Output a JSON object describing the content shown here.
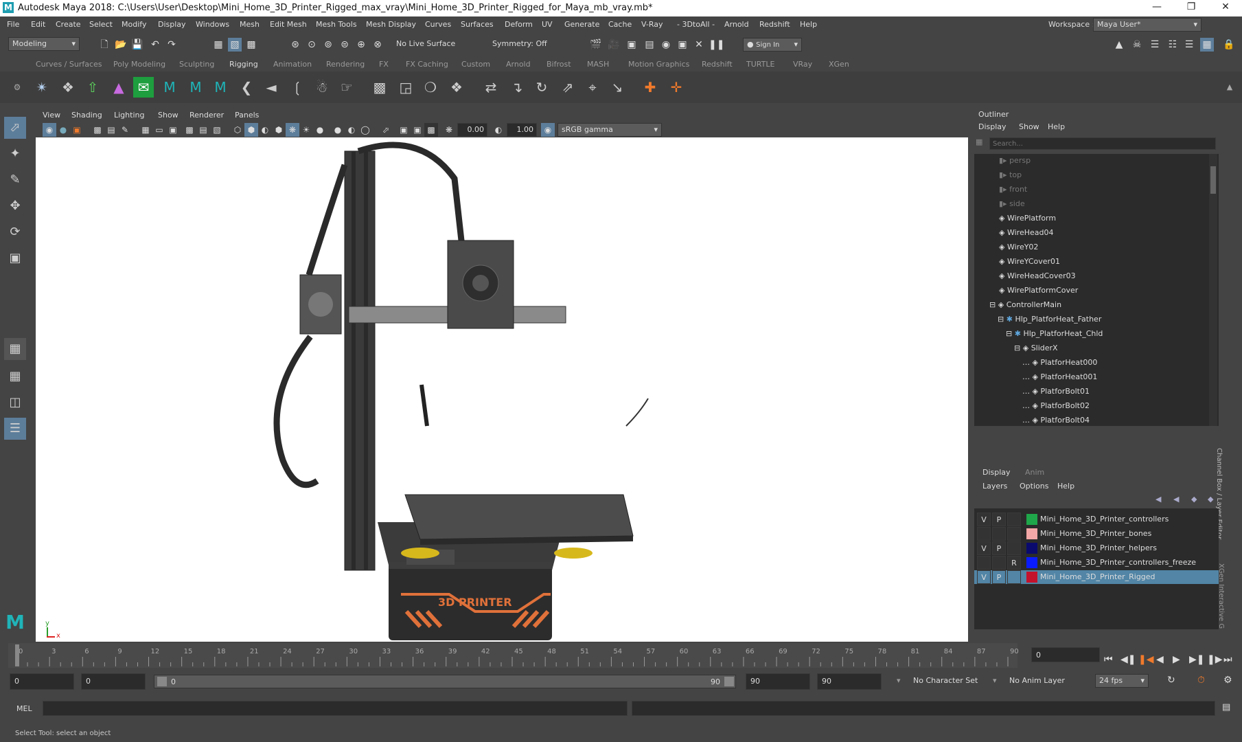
{
  "window": {
    "title": "Autodesk Maya 2018: C:\\Users\\User\\Desktop\\Mini_Home_3D_Printer_Rigged_max_vray\\Mini_Home_3D_Printer_Rigged_for_Maya_mb_vray.mb*"
  },
  "menu": [
    "File",
    "Edit",
    "Create",
    "Select",
    "Modify",
    "Display",
    "Windows",
    "Mesh",
    "Edit Mesh",
    "Mesh Tools",
    "Mesh Display",
    "Curves",
    "Surfaces",
    "Deform",
    "UV",
    "Generate",
    "Cache",
    "V-Ray",
    "- 3DtoAll -",
    "Arnold",
    "Redshift",
    "Help"
  ],
  "workspace": {
    "label": "Workspace :",
    "value": "Maya User*"
  },
  "status": {
    "mode": "Modeling",
    "live_surface": "No Live Surface",
    "symmetry": "Symmetry: Off",
    "sign_in": "Sign In"
  },
  "shelf_tabs": [
    "Curves / Surfaces",
    "Poly Modeling",
    "Sculpting",
    "Rigging",
    "Animation",
    "Rendering",
    "FX",
    "FX Caching",
    "Custom",
    "Arnold",
    "Bifrost",
    "MASH",
    "Motion Graphics",
    "Redshift",
    "TURTLE",
    "VRay",
    "XGen"
  ],
  "shelf_active": "Rigging",
  "panel_menu": [
    "View",
    "Shading",
    "Lighting",
    "Show",
    "Renderer",
    "Panels"
  ],
  "panel_toolbar": {
    "exposure": "0.00",
    "gamma": "1.00",
    "color_space": "sRGB gamma"
  },
  "viewport": {
    "axis_y": "y",
    "axis_x": "x",
    "printer_label": "3D PRINTER"
  },
  "outliner": {
    "title": "Outliner",
    "menu": [
      "Display",
      "Show",
      "Help"
    ],
    "search_placeholder": "Search...",
    "items": [
      "persp",
      "top",
      "front",
      "side",
      "WirePlatform",
      "WireHead04",
      "WireY02",
      "WireYCover01",
      "WireHeadCover03",
      "WirePlatformCover",
      "ControllerMain",
      "Hlp_PlatforHeat_Father",
      "Hlp_PlatforHeat_Chld",
      "SliderX",
      "PlatforHeat000",
      "PlatforHeat001",
      "PlatforBolt01",
      "PlatforBolt02",
      "PlatforBolt04"
    ]
  },
  "layer_editor": {
    "tabs": [
      "Display",
      "Anim"
    ],
    "menu": [
      "Layers",
      "Options",
      "Help"
    ],
    "side_label": "Channel Box / Layer Editor",
    "side_label2": "XGen Interactive G",
    "layers": [
      {
        "v": "V",
        "p": "P",
        "r": "",
        "color": "#1fa64a",
        "name": "Mini_Home_3D_Printer_controllers"
      },
      {
        "v": "",
        "p": "",
        "r": "",
        "color": "#f4a7a7",
        "name": "Mini_Home_3D_Printer_bones"
      },
      {
        "v": "V",
        "p": "P",
        "r": "",
        "color": "#0a0a6e",
        "name": "Mini_Home_3D_Printer_helpers"
      },
      {
        "v": "",
        "p": "",
        "r": "R",
        "color": "#0a1cff",
        "name": "Mini_Home_3D_Printer_controllers_freeze"
      },
      {
        "v": "V",
        "p": "P",
        "r": "",
        "color": "#c4122d",
        "name": "Mini_Home_3D_Printer_Rigged"
      }
    ]
  },
  "timeline": {
    "ticks": [
      "0",
      "3",
      "6",
      "9",
      "12",
      "15",
      "18",
      "21",
      "24",
      "27",
      "30",
      "33",
      "36",
      "39",
      "42",
      "45",
      "48",
      "51",
      "54",
      "57",
      "60",
      "63",
      "66",
      "69",
      "72",
      "75",
      "78",
      "81",
      "84",
      "87",
      "90"
    ],
    "current": "0"
  },
  "range": {
    "start": "0",
    "inner_start": "0",
    "slider_start": "0",
    "slider_end": "90",
    "inner_end": "90",
    "end": "90",
    "character_set": "No Character Set",
    "anim_layer": "No Anim Layer",
    "fps": "24 fps"
  },
  "command": {
    "lang": "MEL"
  },
  "help_line": "Select Tool: select an object"
}
